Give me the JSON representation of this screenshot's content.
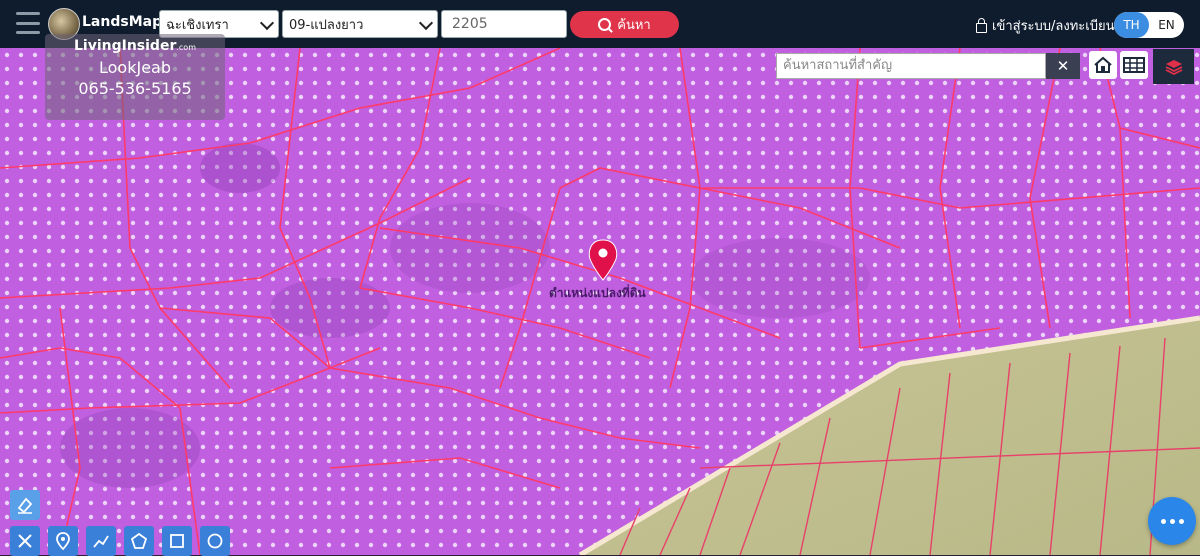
{
  "app": {
    "brand": "LandsMaps"
  },
  "search_bar": {
    "province": "ฉะเชิงเทรา",
    "district": "09-แปลงยาว",
    "parcel_number": "2205",
    "search_label": "ค้นหา"
  },
  "header_right": {
    "login_label": "เข้าสู่ระบบ/ลงทะเบียน",
    "lang_th": "TH",
    "lang_en": "EN"
  },
  "watermark": {
    "logo_text": "LivingInsider",
    "logo_suffix": ".com",
    "agent_name": "LookJeab",
    "phone": "065-536-5165"
  },
  "map": {
    "place_search_placeholder": "ค้นหาสถานที่สำคัญ",
    "clear_symbol": "✕",
    "pin_label": "ตำแหน่งแปลงที่ดิน",
    "colors": {
      "zone_fill": "#c060e0",
      "parcel_line": "#ff3a6a",
      "pin": "#e0104a"
    }
  },
  "icons": [
    "hamburger-icon",
    "search-icon",
    "lock-icon",
    "home-icon",
    "grid-icon",
    "layers-icon",
    "eraser-icon",
    "measure-icon",
    "location-icon",
    "line-icon",
    "polygon-icon",
    "rectangle-icon",
    "circle-icon",
    "more-icon"
  ]
}
